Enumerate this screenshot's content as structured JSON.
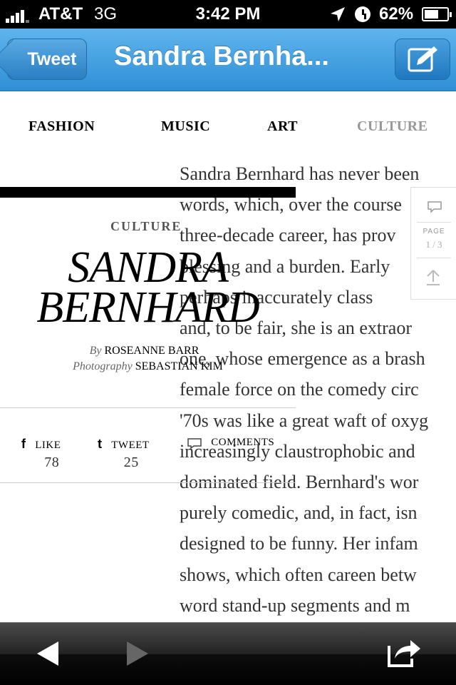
{
  "status_bar": {
    "carrier": "AT&T",
    "network": "3G",
    "time": "3:42 PM",
    "battery_percent": "62%",
    "battery_level": 0.62
  },
  "nav_bar": {
    "back_label": "Tweet",
    "title": "Sandra Bernha..."
  },
  "categories": [
    {
      "label": "FASHION",
      "active": false
    },
    {
      "label": "MUSIC",
      "active": false
    },
    {
      "label": "ART",
      "active": false
    },
    {
      "label": "CULTURE",
      "active": true
    }
  ],
  "article": {
    "kicker": "CULTURE",
    "title_line1": "SANDRA",
    "title_line2": "BERNHARD",
    "by_label": "By",
    "author": "ROSEANNE BARR",
    "photo_label": "Photography",
    "photographer": "SEBASTIAN KIM",
    "body_lines": [
      "Sandra Bernhard has never been",
      "words, which, over the course",
      "three-decade career, has prov",
      "blessing and a burden. Early",
      "perhaps inaccurately class",
      "and, to be fair, she is an extraor",
      "one, whose emergence as a brash",
      "female force on the comedy circ",
      "'70s was like a great waft of oxyg",
      "increasingly claustrophobic and",
      "dominated field. Bernhard's wor",
      "purely comedic, and, in fact, isn",
      "designed to be funny. Her infam",
      "shows, which often careen betw",
      "word stand-up segments and m"
    ]
  },
  "social": {
    "like_label": "LIKE",
    "like_count": "78",
    "tweet_label": "TWEET",
    "tweet_count": "25",
    "comments_label": "COMMENTS"
  },
  "page_widget": {
    "label": "PAGE",
    "page_indicator": "1 / 3"
  },
  "icons": {
    "back": "back-arrow-icon",
    "forward": "forward-arrow-icon",
    "share": "share-icon",
    "compose": "compose-icon",
    "comment": "comment-bubble-icon",
    "scroll_top": "scroll-top-icon"
  },
  "colors": {
    "nav_blue": "#3a9be0",
    "active_category": "#999999",
    "text": "#333333"
  }
}
